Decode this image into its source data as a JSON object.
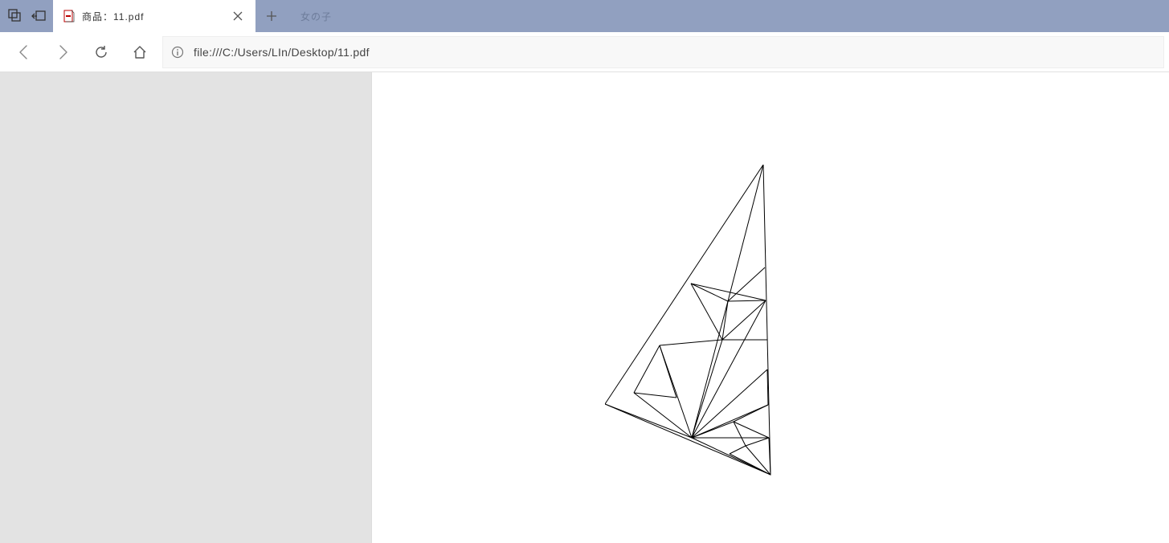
{
  "tabs": {
    "active": {
      "prefix": "商品：",
      "title": "11.pdf"
    },
    "ghost": {
      "title": "女の子"
    }
  },
  "addressbar": {
    "url": "file:///C:/Users/LIn/Desktop/11.pdf"
  }
}
